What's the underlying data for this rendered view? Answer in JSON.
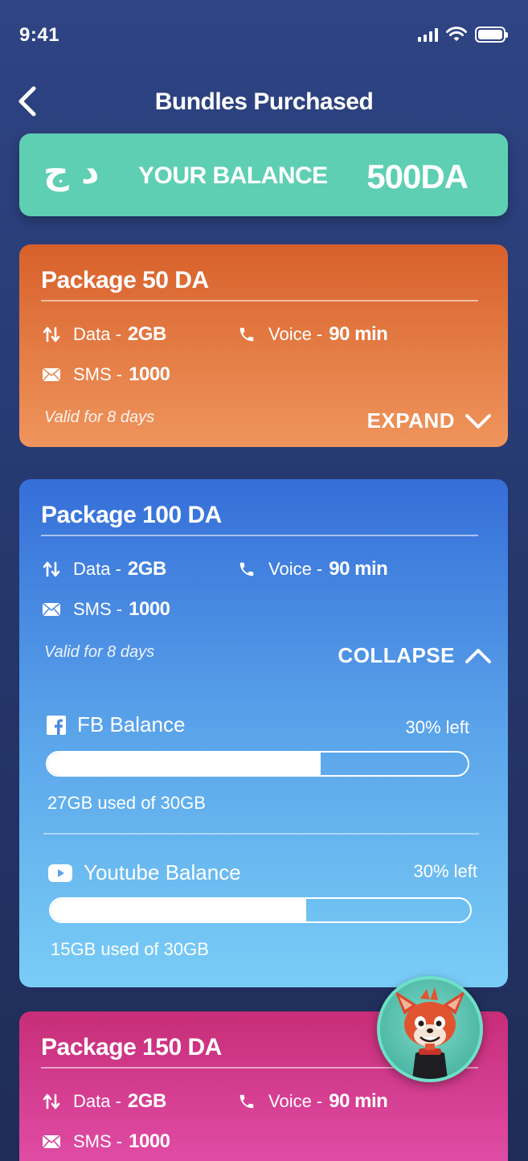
{
  "status_bar": {
    "time": "9:41"
  },
  "header": {
    "title": "Bundles Purchased"
  },
  "balance": {
    "currency_symbol": "د ج",
    "label": "YOUR BALANCE",
    "value": "500DA"
  },
  "packages": [
    {
      "title": "Package 50 DA",
      "data_label": "Data -",
      "data_value": "2GB",
      "voice_label": "Voice -",
      "voice_value": "90 min",
      "sms_label": "SMS -",
      "sms_value": "1000",
      "validity": "Valid for 8 days",
      "toggle_label": "EXPAND",
      "expanded": false,
      "color": "#e07338"
    },
    {
      "title": "Package 100 DA",
      "data_label": "Data -",
      "data_value": "2GB",
      "voice_label": "Voice -",
      "voice_value": "90 min",
      "sms_label": "SMS -",
      "sms_value": "1000",
      "validity": "Valid for 8 days",
      "toggle_label": "COLLAPSE",
      "expanded": true,
      "color": "#4a8be3",
      "balances": [
        {
          "name": "FB Balance",
          "icon": "facebook-icon",
          "left": "30% left",
          "used_fraction": 0.65,
          "usage": "27GB used of 30GB"
        },
        {
          "name": "Youtube Balance",
          "icon": "youtube-icon",
          "left": "30% left",
          "used_fraction": 0.61,
          "usage": "15GB used of 30GB"
        }
      ]
    },
    {
      "title": "Package 150 DA",
      "data_label": "Data -",
      "data_value": "2GB",
      "voice_label": "Voice -",
      "voice_value": "90 min",
      "sms_label": "SMS -",
      "sms_value": "1000",
      "color": "#d13e8f"
    }
  ],
  "colors": {
    "balance_card": "#5ecfb3",
    "background": "#26386f"
  }
}
